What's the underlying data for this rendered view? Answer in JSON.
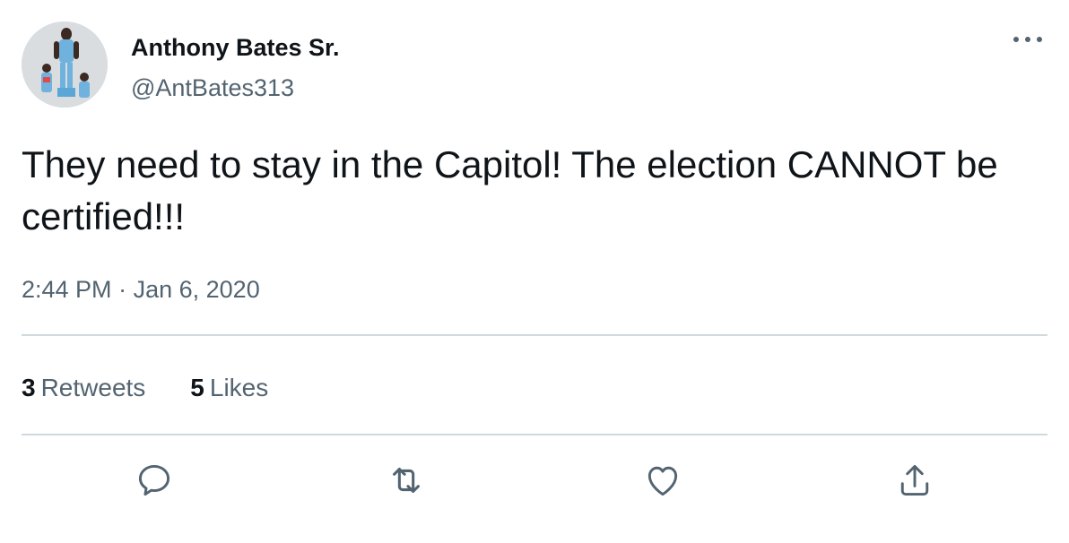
{
  "author": {
    "display_name": "Anthony Bates Sr.",
    "handle": "@AntBates313"
  },
  "tweet": {
    "text": "They need to stay in the Capitol! The election CANNOT be certified!!!",
    "time": "2:44 PM",
    "separator": "·",
    "date": "Jan 6, 2020"
  },
  "stats": {
    "retweets_count": "3",
    "retweets_label": "Retweets",
    "likes_count": "5",
    "likes_label": "Likes"
  },
  "icons": {
    "more": "more-horizontal-icon",
    "reply": "reply-icon",
    "retweet": "retweet-icon",
    "like": "heart-icon",
    "share": "share-icon"
  },
  "colors": {
    "text_primary": "#0f1419",
    "text_secondary": "#536471",
    "divider": "#cfd9de"
  }
}
